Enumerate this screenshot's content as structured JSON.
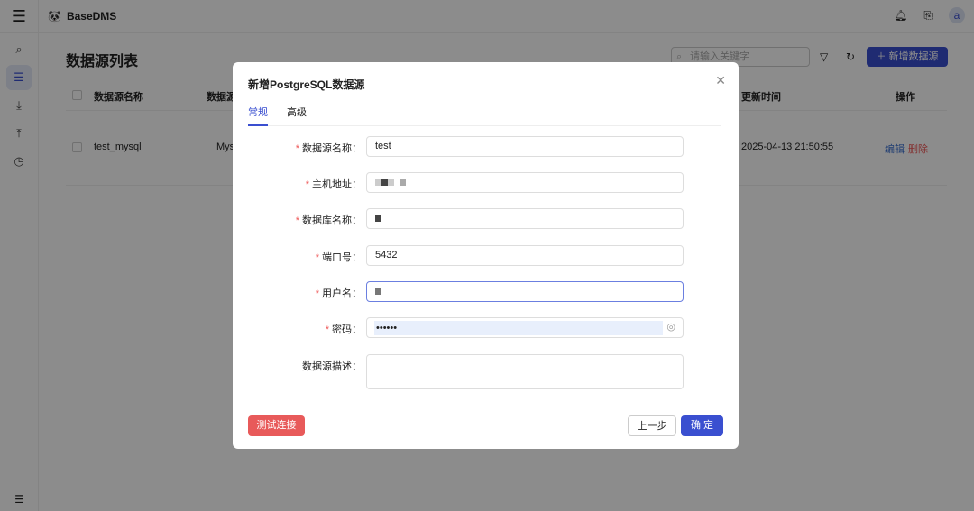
{
  "app": {
    "name": "BaseDMS",
    "avatar": "a"
  },
  "page": {
    "title": "数据源列表",
    "search_placeholder": "请输入关键字",
    "add_button": "新增数据源"
  },
  "table": {
    "headers": [
      "数据源名称",
      "数据源类型",
      "更新时间",
      "操作"
    ],
    "rows": [
      {
        "name": "test_mysql",
        "type": "Mys",
        "updated": "2025-04-13 21:50:55",
        "edit": "编辑",
        "delete": "删除"
      }
    ]
  },
  "modal": {
    "title": "新增PostgreSQL数据源",
    "tabs": [
      "常规",
      "高级"
    ],
    "fields": [
      {
        "label": "数据源名称：",
        "value": "test",
        "required": true
      },
      {
        "label": "主机地址：",
        "value": "",
        "required": true
      },
      {
        "label": "数据库名称：",
        "value": "",
        "required": true
      },
      {
        "label": "端口号：",
        "value": "5432",
        "required": true
      },
      {
        "label": "用户名：",
        "value": "",
        "required": true
      },
      {
        "label": "密码：",
        "value": "••••••",
        "required": true
      },
      {
        "label": "数据源描述：",
        "value": "",
        "required": false
      }
    ],
    "test_button": "测试连接",
    "prev_button": "上一步",
    "ok_button": "确 定"
  },
  "colors": {
    "primary": "#3a4fd0",
    "danger": "#e85a5a"
  }
}
